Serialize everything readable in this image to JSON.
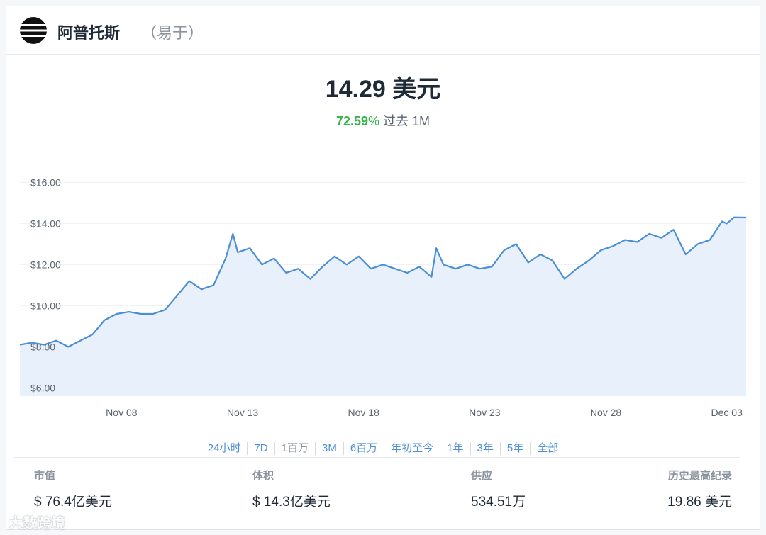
{
  "header": {
    "coin_name": "阿普托斯",
    "coin_symbol": "（易于）"
  },
  "price": {
    "value": "14.29 美元",
    "change_pct": "72.59",
    "change_pct_sign": "%",
    "change_period": "过去 1M"
  },
  "chart_data": {
    "type": "area",
    "title": "",
    "xlabel": "",
    "ylabel": "",
    "ylim": [
      5.6,
      16.6
    ],
    "xlim": [
      0,
      30
    ],
    "y_ticks": [
      6,
      8,
      10,
      12,
      14,
      16
    ],
    "y_tick_labels": [
      "$6.00",
      "$8.00",
      "$10.00",
      "$12.00",
      "$14.00",
      "$16.00"
    ],
    "x_ticks": [
      4.2,
      9.2,
      14.2,
      19.2,
      24.2,
      29.2
    ],
    "x_tick_labels": [
      "Nov 08",
      "Nov 13",
      "Nov 18",
      "Nov 23",
      "Nov 28",
      "Dec 03"
    ],
    "grid": true,
    "legend": "none",
    "colors": {
      "line": "#4a8fd6",
      "fill": "#e8f0fb",
      "grid": "#eef0f3"
    },
    "series": [
      {
        "x": [
          0,
          0.5,
          1,
          1.5,
          2,
          2.5,
          3,
          3.5,
          4,
          4.5,
          5,
          5.5,
          6,
          6.5,
          7,
          7.5,
          8,
          8.5,
          8.8,
          9,
          9.5,
          10,
          10.5,
          11,
          11.5,
          12,
          12.5,
          13,
          13.5,
          14,
          14.5,
          15,
          15.5,
          16,
          16.5,
          17,
          17.2,
          17.5,
          18,
          18.5,
          19,
          19.5,
          20,
          20.5,
          21,
          21.5,
          22,
          22.5,
          23,
          23.5,
          24,
          24.5,
          25,
          25.5,
          26,
          26.5,
          27,
          27.5,
          28,
          28.5,
          29,
          29.2,
          29.5,
          30
        ],
        "y": [
          8.1,
          8.2,
          8.1,
          8.3,
          8.0,
          8.3,
          8.6,
          9.3,
          9.6,
          9.7,
          9.6,
          9.6,
          9.8,
          10.5,
          11.2,
          10.8,
          11.0,
          12.3,
          13.5,
          12.6,
          12.8,
          12.0,
          12.3,
          11.6,
          11.8,
          11.3,
          11.9,
          12.4,
          12.0,
          12.4,
          11.8,
          12.0,
          11.8,
          11.6,
          11.9,
          11.4,
          12.8,
          12.0,
          11.8,
          12.0,
          11.8,
          11.9,
          12.7,
          13.0,
          12.1,
          12.5,
          12.2,
          11.3,
          11.8,
          12.2,
          12.7,
          12.9,
          13.2,
          13.1,
          13.5,
          13.3,
          13.7,
          12.5,
          13.0,
          13.2,
          14.1,
          14.0,
          14.3,
          14.29
        ]
      }
    ]
  },
  "ranges": [
    {
      "label": "24小时",
      "muted": false
    },
    {
      "label": "7D",
      "muted": false
    },
    {
      "label": "1百万",
      "muted": true
    },
    {
      "label": "3M",
      "muted": false
    },
    {
      "label": "6百万",
      "muted": false
    },
    {
      "label": "年初至今",
      "muted": false
    },
    {
      "label": "1年",
      "muted": false
    },
    {
      "label": "3年",
      "muted": false
    },
    {
      "label": "5年",
      "muted": false
    },
    {
      "label": "全部",
      "muted": false
    }
  ],
  "stats": [
    {
      "label": "市值",
      "value": "$ 76.4亿美元"
    },
    {
      "label": "体积",
      "value": "$ 14.3亿美元"
    },
    {
      "label": "供应",
      "value": "534.51万"
    },
    {
      "label": "历史最高纪录",
      "value": "19.86 美元"
    }
  ],
  "watermark": "大数跨境"
}
